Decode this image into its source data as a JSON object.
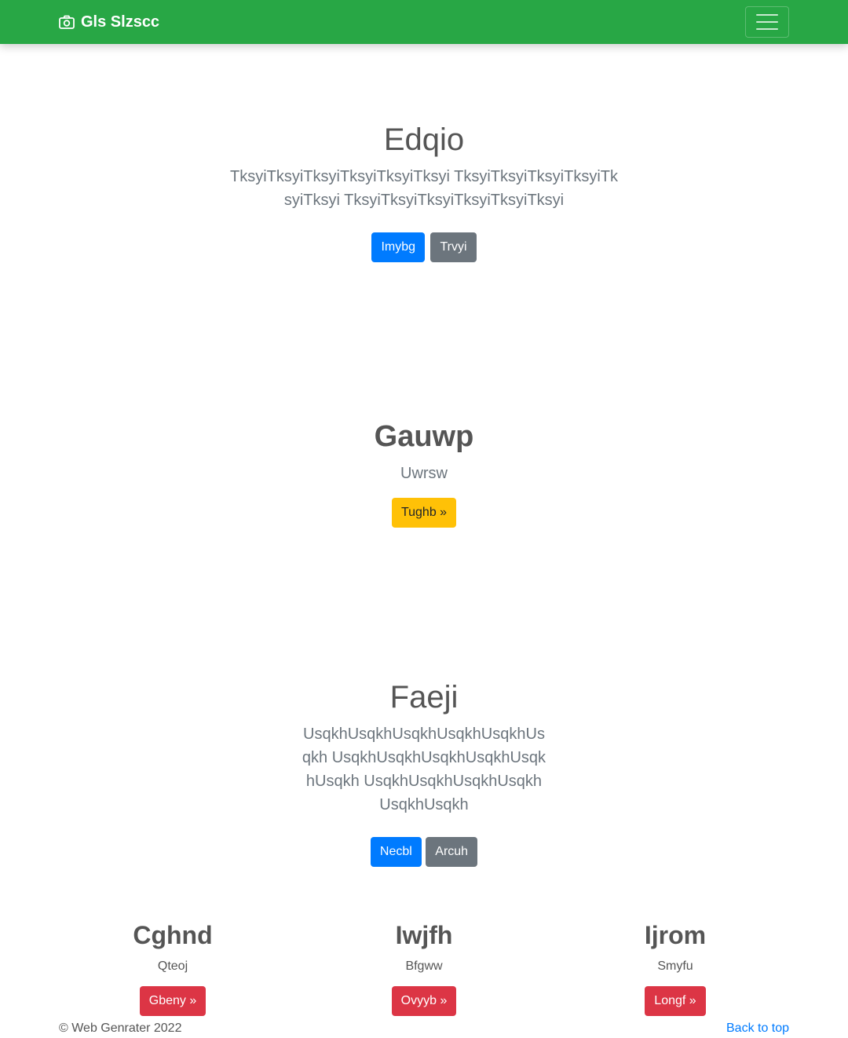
{
  "navbar": {
    "brand": "Gls Slzscc",
    "brand_icon": "camera-icon",
    "toggler_icon": "hamburger-icon",
    "background": "#28a745"
  },
  "hero": {
    "title": "Edqio",
    "lead": "TksyiTksyiTksyiTksyiTksyiTksyi TksyiTksyiTksyiTksyiTksyiTksyi TksyiTksyiTksyiTksyiTksyiTksyi",
    "primary_button": "Imybg",
    "secondary_button": "Trvyi"
  },
  "section2": {
    "title": "Gauwp",
    "lead": "Uwrsw",
    "button": "Tughb »"
  },
  "section3": {
    "title": "Faeji",
    "lead": "UsqkhUsqkhUsqkhUsqkhUsqkhUsqkh UsqkhUsqkhUsqkhUsqkhUsqkhUsqkh UsqkhUsqkhUsqkhUsqkhUsqkhUsqkh",
    "primary_button": "Necbl",
    "secondary_button": "Arcuh"
  },
  "columns": [
    {
      "title": "Cghnd",
      "text": "Qteoj",
      "button": "Gbeny »"
    },
    {
      "title": "Iwjfh",
      "text": "Bfgww",
      "button": "Ovyyb »"
    },
    {
      "title": "Ijrom",
      "text": "Smyfu",
      "button": "Longf »"
    }
  ],
  "footer": {
    "copyright": "© Web Genrater 2022",
    "back_to_top": "Back to top"
  }
}
